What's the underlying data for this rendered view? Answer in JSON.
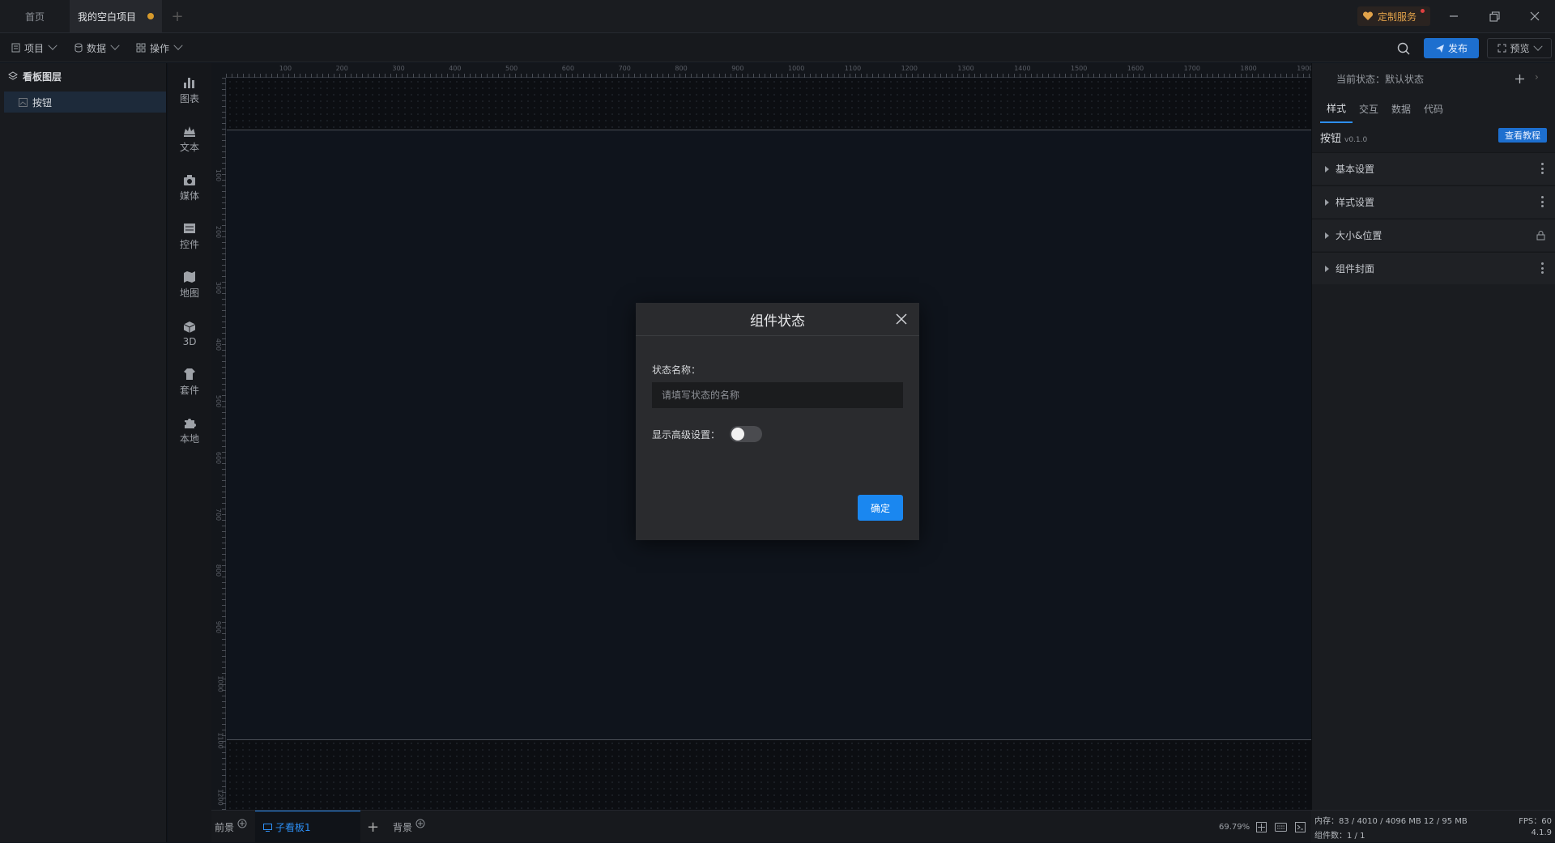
{
  "tabs": {
    "home": "首页",
    "project": "我的空白项目"
  },
  "titlebar": {
    "custom_service": "定制服务"
  },
  "toolbar": {
    "project": "项目",
    "data": "数据",
    "operate": "操作",
    "publish": "发布",
    "preview": "预览"
  },
  "layers": {
    "header": "看板图层",
    "items": [
      {
        "label": "按钮"
      }
    ]
  },
  "components": [
    {
      "label": "图表",
      "icon": "chart-icon"
    },
    {
      "label": "文本",
      "icon": "text-icon"
    },
    {
      "label": "媒体",
      "icon": "media-icon"
    },
    {
      "label": "控件",
      "icon": "widget-icon"
    },
    {
      "label": "地图",
      "icon": "map-icon"
    },
    {
      "label": "3D",
      "icon": "cube-icon"
    },
    {
      "label": "套件",
      "icon": "kit-icon"
    },
    {
      "label": "本地",
      "icon": "puzzle-icon"
    }
  ],
  "ruler": {
    "top": [
      "100",
      "200",
      "300",
      "400",
      "500",
      "600",
      "700",
      "800",
      "900",
      "1000",
      "1100",
      "1200",
      "1300",
      "1400",
      "1500",
      "1600",
      "1700",
      "1800",
      "1900"
    ],
    "left": [
      "100",
      "200",
      "300",
      "400",
      "500",
      "600",
      "700",
      "800",
      "900",
      "1000",
      "1100",
      "1200",
      "1300"
    ]
  },
  "bottom": {
    "foreground": "前景",
    "sub_board": "子看板1",
    "background": "背景",
    "zoom": "69.79%"
  },
  "right_panel": {
    "current_state_label": "当前状态：",
    "current_state_value": "默认状态",
    "tabs": [
      "样式",
      "交互",
      "数据",
      "代码"
    ],
    "component_name": "按钮",
    "version": "v0.1.0",
    "tutorial": "查看教程",
    "sections": [
      "基本设置",
      "样式设置",
      "大小&位置",
      "组件封面"
    ]
  },
  "status": {
    "memory_label": "内存：",
    "memory_value": "83 / 4010 / 4096 MB  12 / 95 MB",
    "fps_label": "FPS：",
    "fps_value": "60",
    "count_label": "组件数：",
    "count_value": "1 / 1",
    "version": "4.1.9"
  },
  "dialog": {
    "title": "组件状态",
    "name_label": "状态名称：",
    "name_placeholder": "请填写状态的名称",
    "advanced_label": "显示高级设置：",
    "advanced_enabled": false,
    "ok": "确定"
  },
  "colors": {
    "accent": "#1a87f0",
    "tab_dot": "#d69a2c",
    "service": "#e1a24a"
  }
}
